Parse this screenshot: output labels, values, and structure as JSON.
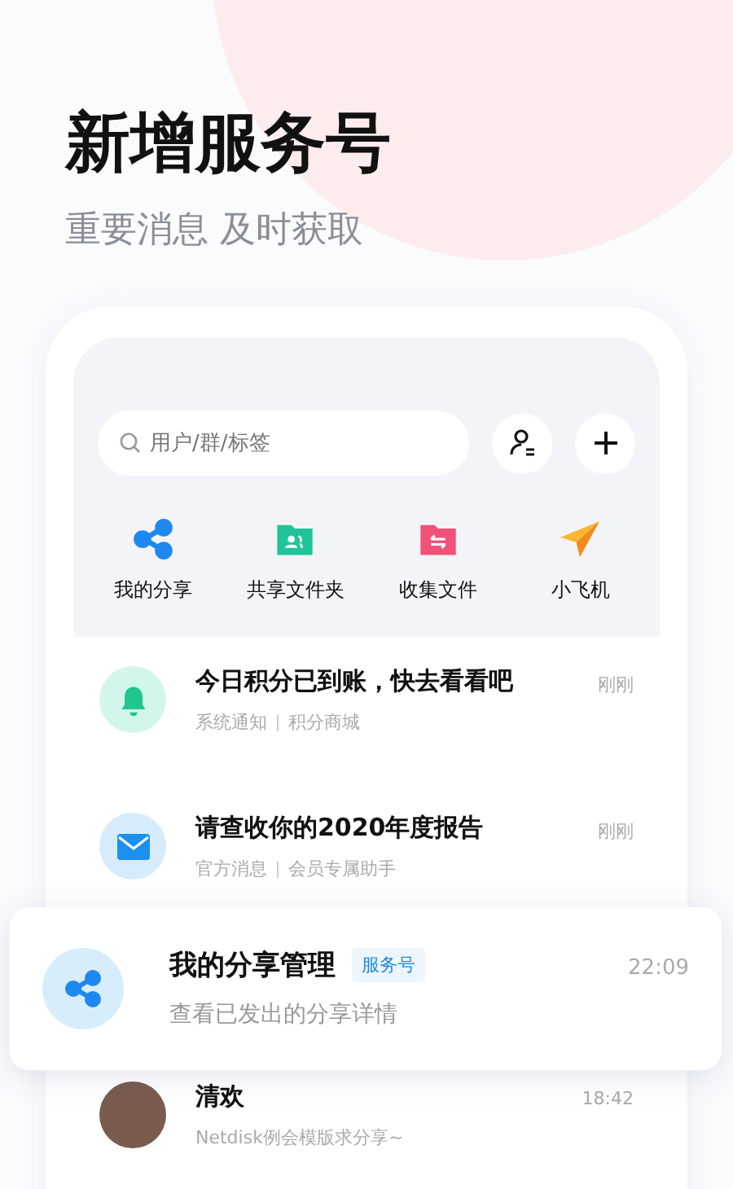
{
  "heading": {
    "title": "新增服务号",
    "subtitle": "重要消息 及时获取"
  },
  "search": {
    "placeholder": "用户/群/标签"
  },
  "shortcuts": [
    {
      "label": "我的分享",
      "kind": "share"
    },
    {
      "label": "共享文件夹",
      "kind": "shared-folder"
    },
    {
      "label": "收集文件",
      "kind": "collect-folder"
    },
    {
      "label": "小飞机",
      "kind": "plane"
    }
  ],
  "messages": [
    {
      "kind": "bell",
      "title": "今日积分已到账，快去看看吧",
      "tags": [
        "系统通知",
        "积分商城"
      ],
      "time": "刚刚"
    },
    {
      "kind": "mail",
      "title": "请查收你的2020年度报告",
      "tags": [
        "官方消息",
        "会员专属助手"
      ],
      "time": "刚刚"
    },
    {
      "kind": "photo",
      "title": "清欢",
      "tags": [
        "Netdisk例会模版求分享~"
      ],
      "time": "18:42"
    }
  ],
  "featured": {
    "title": "我的分享管理",
    "badge": "服务号",
    "subtitle": "查看已发出的分享详情",
    "time": "22:09"
  }
}
